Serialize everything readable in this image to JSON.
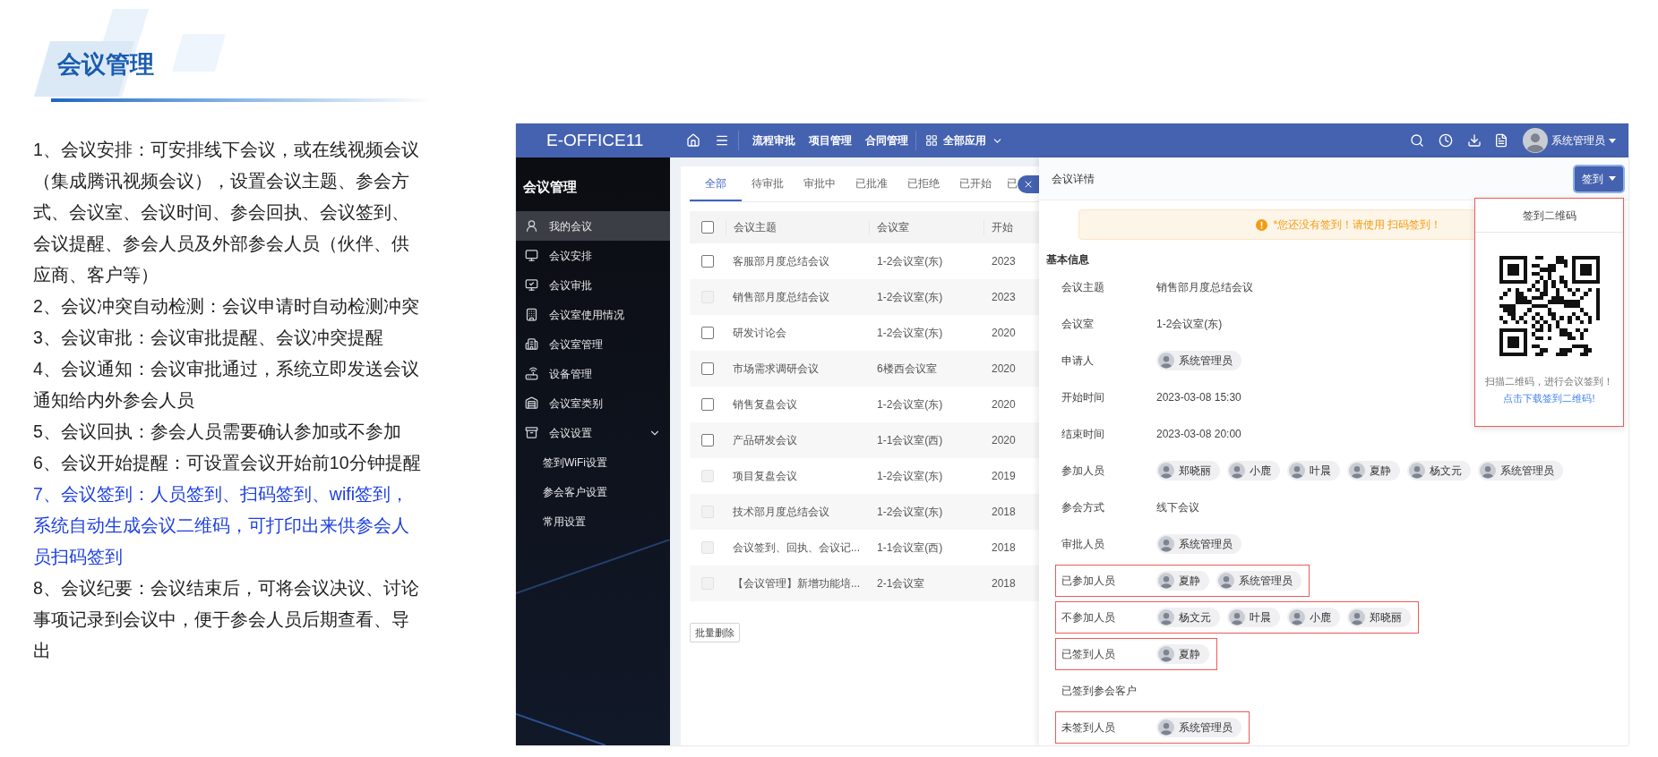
{
  "slide": {
    "title": "会议管理",
    "points": [
      {
        "text": "1、会议安排：可安排线下会议，或在线视频会议（集成腾讯视频会议），设置会议主题、参会方式、会议室、会议时间、参会回执、会议签到、会议提醒、参会人员及外部参会人员（伙伴、供应商、客户等）",
        "highlighted": false
      },
      {
        "text": "2、会议冲突自动检测：会议申请时自动检测冲突",
        "highlighted": false
      },
      {
        "text": "3、会议审批：会议审批提醒、会议冲突提醒",
        "highlighted": false
      },
      {
        "text": "4、会议通知：会议审批通过，系统立即发送会议通知给内外参会人员",
        "highlighted": false
      },
      {
        "text": "5、会议回执：参会人员需要确认参加或不参加",
        "highlighted": false
      },
      {
        "text": "6、会议开始提醒：可设置会议开始前10分钟提醒",
        "highlighted": false
      },
      {
        "text": "7、会议签到：人员签到、扫码签到、wifi签到，系统自动生成会议二维码，可打印出来供参会人员扫码签到",
        "highlighted": true
      },
      {
        "text": "8、会议纪要：会议结束后，可将会议决议、讨论事项记录到会议中，便于参会人员后期查看、导出",
        "highlighted": false
      }
    ]
  },
  "app": {
    "logo": "E-OFFICE11",
    "nav": [
      "流程审批",
      "项目管理",
      "合同管理"
    ],
    "apps_menu": "全部应用",
    "user": "系统管理员",
    "sidebar": {
      "title": "会议管理",
      "items": [
        {
          "label": "我的会议",
          "selected": true
        },
        {
          "label": "会议安排",
          "selected": false
        },
        {
          "label": "会议审批",
          "selected": false
        },
        {
          "label": "会议室使用情况",
          "selected": false
        },
        {
          "label": "会议室管理",
          "selected": false
        },
        {
          "label": "设备管理",
          "selected": false
        },
        {
          "label": "会议室类别",
          "selected": false
        },
        {
          "label": "会议设置",
          "selected": false,
          "expanded": true,
          "children": [
            {
              "label": "签到WiFi设置",
              "selected": false
            },
            {
              "label": "参会客户设置",
              "selected": false
            },
            {
              "label": "常用设置",
              "selected": false
            }
          ]
        }
      ]
    },
    "tabs": [
      {
        "label": "全部",
        "selected": true
      },
      {
        "label": "待审批",
        "selected": false
      },
      {
        "label": "审批中",
        "selected": false
      },
      {
        "label": "已批准",
        "selected": false
      },
      {
        "label": "已拒绝",
        "selected": false
      },
      {
        "label": "已开始",
        "selected": false
      },
      {
        "label": "已",
        "selected": false
      }
    ],
    "table": {
      "columns": [
        "会议主题",
        "会议室",
        "开始"
      ],
      "select_all": {
        "checked": false
      },
      "rows": [
        {
          "subject": "客服部月度总结会议",
          "room": "1-2会议室(东)",
          "start": "2023",
          "disabled": false
        },
        {
          "subject": "销售部月度总结会议",
          "room": "1-2会议室(东)",
          "start": "2023",
          "disabled": true
        },
        {
          "subject": "研发讨论会",
          "room": "1-2会议室(东)",
          "start": "2020",
          "disabled": false
        },
        {
          "subject": "市场需求调研会议",
          "room": "6楼西会议室",
          "start": "2020",
          "disabled": false
        },
        {
          "subject": "销售复盘会议",
          "room": "1-2会议室(东)",
          "start": "2020",
          "disabled": false
        },
        {
          "subject": "产品研发会议",
          "room": "1-1会议室(西)",
          "start": "2020",
          "disabled": false
        },
        {
          "subject": "项目复盘会议",
          "room": "1-2会议室(东)",
          "start": "2019",
          "disabled": true
        },
        {
          "subject": "技术部月度总结会议",
          "room": "1-2会议室(东)",
          "start": "2018",
          "disabled": true
        },
        {
          "subject": "会议签到、回执、会议记...",
          "room": "1-1会议室(西)",
          "start": "2018",
          "disabled": true
        },
        {
          "subject": "【会议管理】新增功能培...",
          "room": "2-1会议室",
          "start": "2018",
          "disabled": true
        }
      ]
    },
    "bulk_delete": "批量删除",
    "detail": {
      "title": "会议详情",
      "sign_in_button": "签到",
      "notice": "*您还没有签到！请使用 扫码签到！",
      "section": "基本信息",
      "fields": [
        {
          "label": "会议主题",
          "kind": "text",
          "value": "销售部月度总结会议",
          "highlighted": false
        },
        {
          "label": "会议室",
          "kind": "text",
          "value": "1-2会议室(东)",
          "highlighted": false
        },
        {
          "label": "申请人",
          "kind": "people",
          "people": [
            "系统管理员"
          ],
          "highlighted": false
        },
        {
          "label": "开始时间",
          "kind": "text",
          "value": "2023-03-08 15:30",
          "highlighted": false
        },
        {
          "label": "结束时间",
          "kind": "text",
          "value": "2023-03-08 20:00",
          "highlighted": false
        },
        {
          "label": "参加人员",
          "kind": "people",
          "people": [
            "郑晓丽",
            "小鹿",
            "叶晨",
            "夏静",
            "杨文元",
            "系统管理员"
          ],
          "highlighted": false
        },
        {
          "label": "参会方式",
          "kind": "text",
          "value": "线下会议",
          "highlighted": false
        },
        {
          "label": "审批人员",
          "kind": "people",
          "people": [
            "系统管理员"
          ],
          "highlighted": false
        },
        {
          "label": "已参加人员",
          "kind": "people",
          "people": [
            "夏静",
            "系统管理员"
          ],
          "highlighted": true
        },
        {
          "label": "不参加人员",
          "kind": "people",
          "people": [
            "杨文元",
            "叶晨",
            "小鹿",
            "郑晓丽"
          ],
          "highlighted": true
        },
        {
          "label": "已签到人员",
          "kind": "people",
          "people": [
            "夏静"
          ],
          "highlighted": true
        },
        {
          "label": "已签到参会客户",
          "kind": "empty",
          "highlighted": false
        },
        {
          "label": "未签到人员",
          "kind": "people",
          "people": [
            "系统管理员"
          ],
          "highlighted": true
        }
      ]
    },
    "qr_popover": {
      "title": "签到二维码",
      "hint": "扫描二维码，进行会议签到！",
      "link": "点击下载签到二维码!",
      "highlighted": true
    }
  }
}
